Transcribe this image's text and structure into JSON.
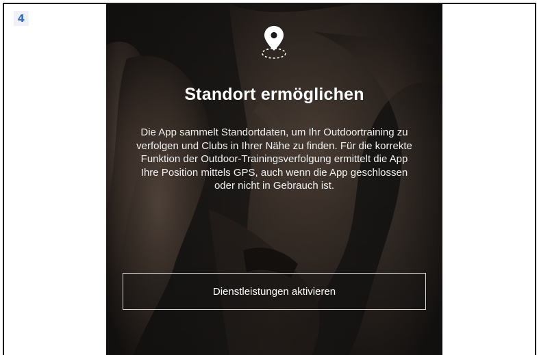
{
  "step": {
    "number": "4",
    "badge_color": "#2f6fd0"
  },
  "screen": {
    "icon": "location-pin-icon",
    "title": "Standort ermöglichen",
    "description": "Die App sammelt Standortdaten, um Ihr Outdoortraining zu verfolgen und Clubs in Ihrer Nähe zu finden. Für die korrekte Funktion der Outdoor-Trainingsverfolgung ermittelt die App Ihre Position mittels GPS, auch wenn die App geschlossen oder nicht in Gebrauch ist.",
    "button_label": "Dienstleistungen aktivieren"
  }
}
